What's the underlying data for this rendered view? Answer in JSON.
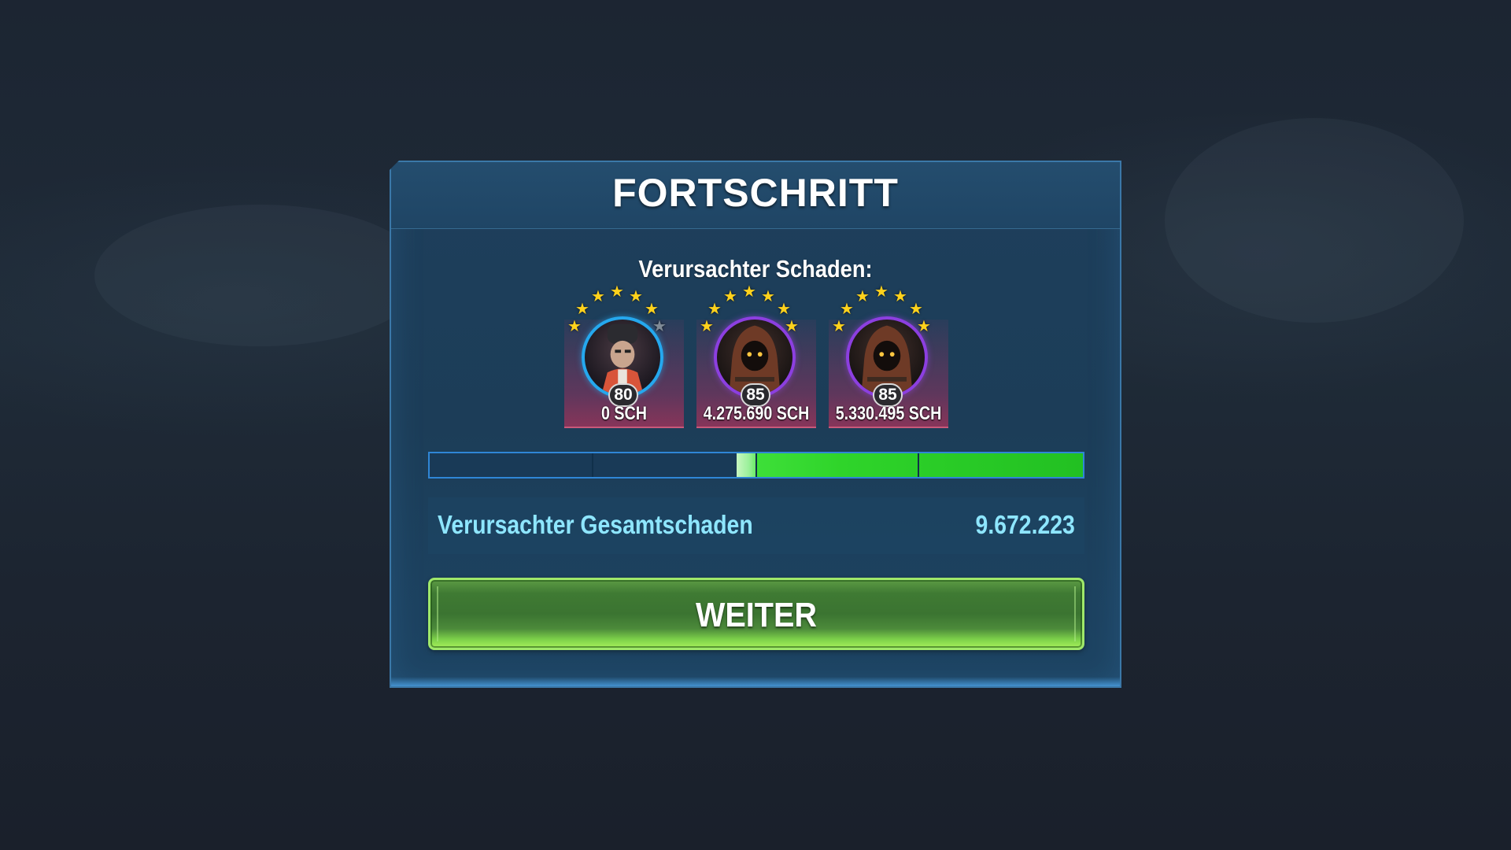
{
  "dialog": {
    "title": "FORTSCHRITT",
    "subtitle": "Verursachter Schaden:"
  },
  "units": [
    {
      "level": "80",
      "damage": "0 SCH",
      "stars_total": 7,
      "stars_filled": 6,
      "ring_color": "#25a8ee"
    },
    {
      "level": "85",
      "damage": "4.275.690 SCH",
      "stars_total": 7,
      "stars_filled": 7,
      "ring_color": "#8c3fe0"
    },
    {
      "level": "85",
      "damage": "5.330.495 SCH",
      "stars_total": 7,
      "stars_filled": 7,
      "ring_color": "#8c3fe0"
    }
  ],
  "progress": {
    "filled_fraction": 0.53,
    "segments": 4,
    "fill_color": "#2fd42a",
    "empty_color": "#193a57"
  },
  "total": {
    "label": "Verursachter Gesamtschaden",
    "value": "9.672.223"
  },
  "continue_button": {
    "label": "WEITER",
    "color": "#4c8a3a"
  },
  "icons": {
    "star": "star-icon",
    "unit_portrait": "character-portrait-icon"
  }
}
